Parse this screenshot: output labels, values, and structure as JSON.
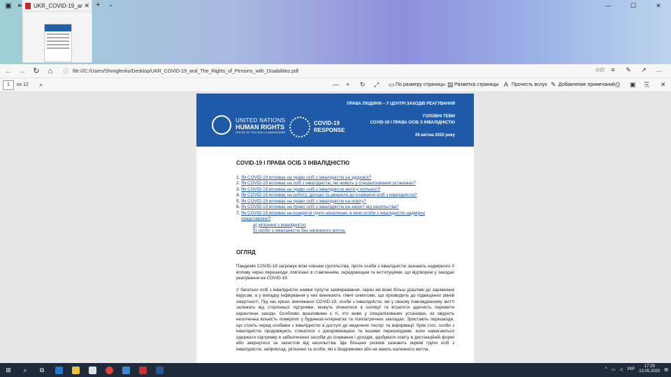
{
  "titlebar": {
    "tab_title": "UKR_COVID-19_and_Th",
    "new_tab": "+",
    "tab_close": "✕",
    "chevron": "⌄"
  },
  "address_bar": {
    "url": "file:///C:/Users/Shmiglenko/Desktop/UKR_COVID-19_and_The_Rights_of_Persons_with_Disabilities.pdf"
  },
  "pdf_toolbar": {
    "page_current": "1",
    "page_total": "из 12",
    "fit_page": "По размеру страницы",
    "page_layout": "Разметка страницы",
    "read_aloud": "Прочесть вслух",
    "add_notes": "Добавление примечаний"
  },
  "document": {
    "banner": {
      "line1": "ПРАВА ЛЮДИНИ – У ЦЕНТРІ ЗАХОДІВ РЕАГУВАННЯ",
      "line2": "ГОЛОВНІ ТЕМИ",
      "line3": "COVID-19 І ПРАВА ОСІБ З ІНВАЛІДНІСТЮ",
      "date": "29 квітня 2020 року",
      "un_line1": "UNITED NATIONS",
      "un_line2": "HUMAN RIGHTS",
      "un_line3": "OFFICE OF THE HIGH COMMISSIONER",
      "covid1": "COVID-19",
      "covid2": "RESPONSE"
    },
    "title": "COVID-19 І ПРАВА ОСІБ З ІНВАЛІДНІСТЮ",
    "toc": [
      {
        "num": "1.",
        "text": "Як COVID-19 впливає на право осіб з інвалідністю на здоров'я?"
      },
      {
        "num": "2.",
        "text": "Як COVID-19 впливає на осіб з інвалідністю, які живуть у спеціалізованих установах?"
      },
      {
        "num": "3.",
        "text": "Як COVID-19 впливає на право осіб з інвалідністю жити у спільноті?"
      },
      {
        "num": "4.",
        "text": "Як COVID-19 впливає на роботу, доходи та джерела до існування осіб з інвалідністю?"
      },
      {
        "num": "5.",
        "text": "Як COVID-19 впливає на право осіб з інвалідністю на освіту?"
      },
      {
        "num": "6.",
        "text": "Як COVID-19 впливає на право осіб з інвалідністю на захист від насильства?"
      },
      {
        "num": "7.",
        "text": "Як COVID-19 впливає на конкретні групи населення, в яких особи з інвалідністю надмірно представлені?"
      }
    ],
    "toc_sub": [
      "а) ув'язнені з інвалідністю",
      "б) особи з інвалідністю без належного житла."
    ],
    "overview_heading": "ОГЛЯД",
    "para1": "Пандемія COVID-19 загрожує всім членам суспільства, проте особи з інвалідністю зазнають надмірного її впливу через перешкоди, пов'язані зі ставленням, середовищем та інституціями, що відтворені у заходах реагування на COVID-19.",
    "para2": "У багатьох осіб з інвалідністю наявні супутні захворювання, через які вони більш уразливі до зараження вірусом, а у випадку інфікування у них виникають тяжчі симптоми, що призводить до підвищених рівнів смертності. Під час кризи, викликаної COVID-19, особи з інвалідністю, які у своєму повсякденному житті залежать від сторонньої підтримки, можуть опинитися в ізоляції та втратити здатність пережити карантинні заходи. Особливо вразливими є ті, хто живе у спеціалізованих установах, як свідчить незліченна кількість померлих у будинках-інтернатах та психіатричних закладах. Зростають перешкоди, що стоять перед особами з інвалідністю в доступі до медичних послуг та інформації. Крім того, особи з інвалідністю продовжують стикатися з дискримінацією та іншими перешкодами, коли намагаються одержати підтримку в забезпеченні засобів до існування і доходів, здобувати освіту в дистанційній формі або звернутися за захистом від насильства. Ще більших ризиків зазнають окремі групи осіб з інвалідністю, наприклад, ув'язнені та особи, які є бездомними або не мають належного житла."
  },
  "taskbar": {
    "lang": "УКР",
    "time": "17:29",
    "date": "13.05.2020"
  }
}
